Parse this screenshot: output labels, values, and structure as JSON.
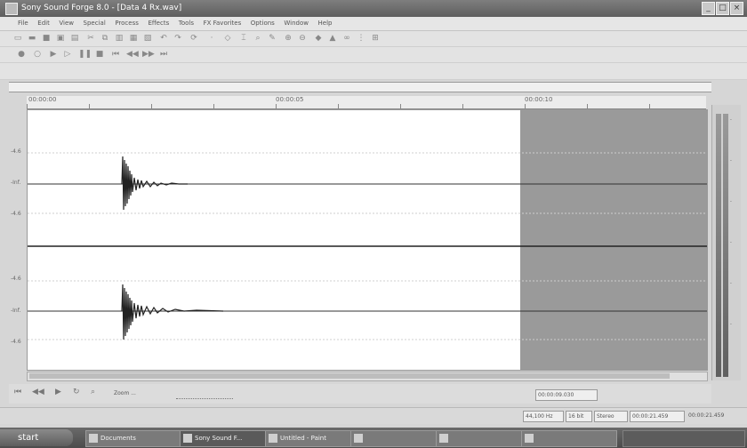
{
  "window": {
    "title": "Sony Sound Forge 8.0 - [Data 4 Rx.wav]",
    "buttons": {
      "minimize": "_",
      "maximize": "□",
      "close": "×"
    }
  },
  "menu": [
    "File",
    "Edit",
    "View",
    "Special",
    "Process",
    "Effects",
    "Tools",
    "FX Favorites",
    "Options",
    "Window",
    "Help"
  ],
  "timeline": {
    "marks": [
      "00:00:00",
      "00:00:05",
      "00:00:10"
    ]
  },
  "amplitude_labels": {
    "top": [
      "-4.6",
      "-Inf.",
      "-4.6"
    ],
    "bottom": [
      "-4.6",
      "-Inf.",
      "-4.6"
    ]
  },
  "transport": {
    "zoom_label": "Zoom ...",
    "cursor_time": "00:00:09.030",
    "selection_start": "00:00:09.030",
    "selection_end": "00:00:21.459"
  },
  "status": {
    "rate": "44,100 Hz",
    "bits": "16 bit",
    "channels": "Stereo",
    "length": "00:00:21.459"
  },
  "taskbar": {
    "start_label": "start",
    "tasks": [
      "Documents",
      "Sony Sound F...",
      "Untitled - Paint",
      "",
      "",
      ""
    ]
  },
  "colors": {
    "titlebar": "#6c6c6c",
    "waveform": "#222222",
    "selection": "#9a9a9a"
  }
}
